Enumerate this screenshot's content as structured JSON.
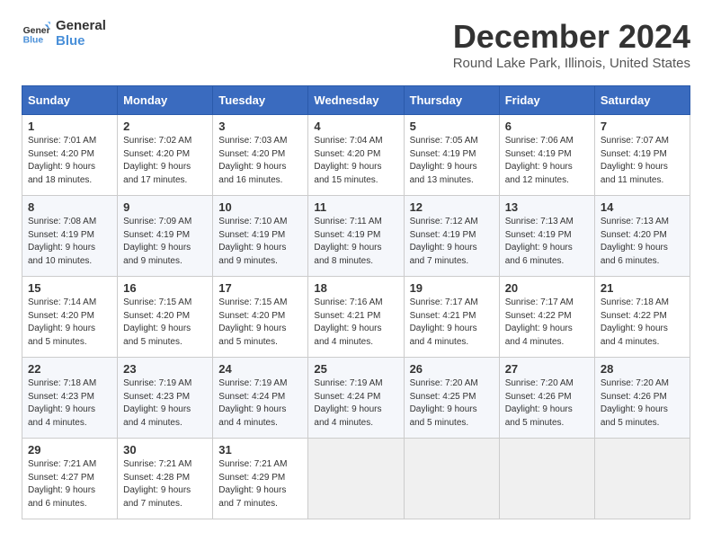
{
  "logo": {
    "text_general": "General",
    "text_blue": "Blue"
  },
  "title": "December 2024",
  "location": "Round Lake Park, Illinois, United States",
  "days_of_week": [
    "Sunday",
    "Monday",
    "Tuesday",
    "Wednesday",
    "Thursday",
    "Friday",
    "Saturday"
  ],
  "weeks": [
    [
      {
        "day": "1",
        "sunrise": "7:01 AM",
        "sunset": "4:20 PM",
        "daylight": "9 hours and 18 minutes."
      },
      {
        "day": "2",
        "sunrise": "7:02 AM",
        "sunset": "4:20 PM",
        "daylight": "9 hours and 17 minutes."
      },
      {
        "day": "3",
        "sunrise": "7:03 AM",
        "sunset": "4:20 PM",
        "daylight": "9 hours and 16 minutes."
      },
      {
        "day": "4",
        "sunrise": "7:04 AM",
        "sunset": "4:20 PM",
        "daylight": "9 hours and 15 minutes."
      },
      {
        "day": "5",
        "sunrise": "7:05 AM",
        "sunset": "4:19 PM",
        "daylight": "9 hours and 13 minutes."
      },
      {
        "day": "6",
        "sunrise": "7:06 AM",
        "sunset": "4:19 PM",
        "daylight": "9 hours and 12 minutes."
      },
      {
        "day": "7",
        "sunrise": "7:07 AM",
        "sunset": "4:19 PM",
        "daylight": "9 hours and 11 minutes."
      }
    ],
    [
      {
        "day": "8",
        "sunrise": "7:08 AM",
        "sunset": "4:19 PM",
        "daylight": "9 hours and 10 minutes."
      },
      {
        "day": "9",
        "sunrise": "7:09 AM",
        "sunset": "4:19 PM",
        "daylight": "9 hours and 9 minutes."
      },
      {
        "day": "10",
        "sunrise": "7:10 AM",
        "sunset": "4:19 PM",
        "daylight": "9 hours and 9 minutes."
      },
      {
        "day": "11",
        "sunrise": "7:11 AM",
        "sunset": "4:19 PM",
        "daylight": "9 hours and 8 minutes."
      },
      {
        "day": "12",
        "sunrise": "7:12 AM",
        "sunset": "4:19 PM",
        "daylight": "9 hours and 7 minutes."
      },
      {
        "day": "13",
        "sunrise": "7:13 AM",
        "sunset": "4:19 PM",
        "daylight": "9 hours and 6 minutes."
      },
      {
        "day": "14",
        "sunrise": "7:13 AM",
        "sunset": "4:20 PM",
        "daylight": "9 hours and 6 minutes."
      }
    ],
    [
      {
        "day": "15",
        "sunrise": "7:14 AM",
        "sunset": "4:20 PM",
        "daylight": "9 hours and 5 minutes."
      },
      {
        "day": "16",
        "sunrise": "7:15 AM",
        "sunset": "4:20 PM",
        "daylight": "9 hours and 5 minutes."
      },
      {
        "day": "17",
        "sunrise": "7:15 AM",
        "sunset": "4:20 PM",
        "daylight": "9 hours and 5 minutes."
      },
      {
        "day": "18",
        "sunrise": "7:16 AM",
        "sunset": "4:21 PM",
        "daylight": "9 hours and 4 minutes."
      },
      {
        "day": "19",
        "sunrise": "7:17 AM",
        "sunset": "4:21 PM",
        "daylight": "9 hours and 4 minutes."
      },
      {
        "day": "20",
        "sunrise": "7:17 AM",
        "sunset": "4:22 PM",
        "daylight": "9 hours and 4 minutes."
      },
      {
        "day": "21",
        "sunrise": "7:18 AM",
        "sunset": "4:22 PM",
        "daylight": "9 hours and 4 minutes."
      }
    ],
    [
      {
        "day": "22",
        "sunrise": "7:18 AM",
        "sunset": "4:23 PM",
        "daylight": "9 hours and 4 minutes."
      },
      {
        "day": "23",
        "sunrise": "7:19 AM",
        "sunset": "4:23 PM",
        "daylight": "9 hours and 4 minutes."
      },
      {
        "day": "24",
        "sunrise": "7:19 AM",
        "sunset": "4:24 PM",
        "daylight": "9 hours and 4 minutes."
      },
      {
        "day": "25",
        "sunrise": "7:19 AM",
        "sunset": "4:24 PM",
        "daylight": "9 hours and 4 minutes."
      },
      {
        "day": "26",
        "sunrise": "7:20 AM",
        "sunset": "4:25 PM",
        "daylight": "9 hours and 5 minutes."
      },
      {
        "day": "27",
        "sunrise": "7:20 AM",
        "sunset": "4:26 PM",
        "daylight": "9 hours and 5 minutes."
      },
      {
        "day": "28",
        "sunrise": "7:20 AM",
        "sunset": "4:26 PM",
        "daylight": "9 hours and 5 minutes."
      }
    ],
    [
      {
        "day": "29",
        "sunrise": "7:21 AM",
        "sunset": "4:27 PM",
        "daylight": "9 hours and 6 minutes."
      },
      {
        "day": "30",
        "sunrise": "7:21 AM",
        "sunset": "4:28 PM",
        "daylight": "9 hours and 7 minutes."
      },
      {
        "day": "31",
        "sunrise": "7:21 AM",
        "sunset": "4:29 PM",
        "daylight": "9 hours and 7 minutes."
      },
      null,
      null,
      null,
      null
    ]
  ]
}
